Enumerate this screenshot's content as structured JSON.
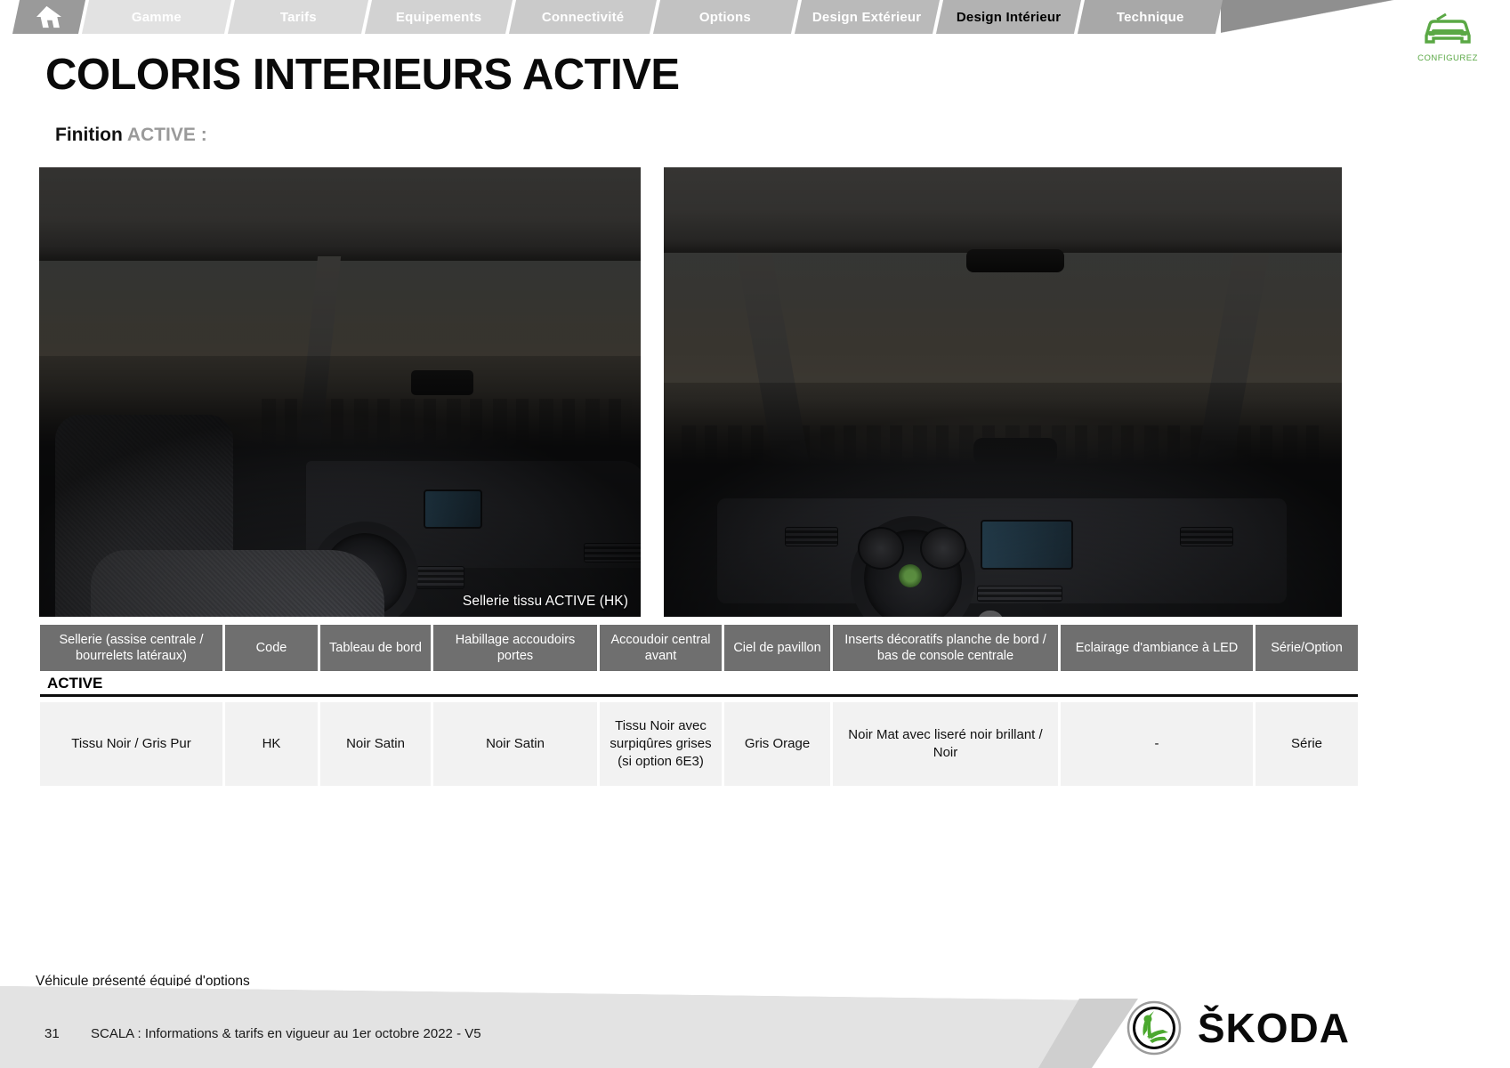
{
  "nav": {
    "home_icon": "home-icon",
    "tabs": [
      {
        "label": "Gamme",
        "active": false,
        "bg": "#e2e2e2"
      },
      {
        "label": "Tarifs",
        "active": false,
        "bg": "#dadada"
      },
      {
        "label": "Equipements",
        "active": false,
        "bg": "#d2d2d2"
      },
      {
        "label": "Connectivité",
        "active": false,
        "bg": "#cacaca"
      },
      {
        "label": "Options",
        "active": false,
        "bg": "#c2c2c2"
      },
      {
        "label": "Design Extérieur",
        "active": false,
        "bg": "#bababa"
      },
      {
        "label": "Design Intérieur",
        "active": true,
        "bg": "#b2b2b2"
      },
      {
        "label": "Technique",
        "active": false,
        "bg": "#a8a8a8"
      }
    ],
    "home_bg": "#9a9a9a"
  },
  "configurez": {
    "label": "CONFIGUREZ",
    "icon": "car-front-icon",
    "color": "#5aa845"
  },
  "header": {
    "title": "COLORIS INTERIEURS ACTIVE",
    "finition_label": "Finition",
    "finition_value": "ACTIVE :"
  },
  "photos": [
    {
      "name": "interior-seats-photo",
      "caption": ""
    },
    {
      "name": "interior-dashboard-photo",
      "caption": "Sellerie tissu ACTIVE (HK)"
    }
  ],
  "photo_caption": "Sellerie tissu ACTIVE (HK)",
  "table": {
    "headers": [
      "Sellerie (assise centrale / bourrelets latéraux)",
      "Code",
      "Tableau de bord",
      "Habillage accoudoirs portes",
      "Accoudoir central avant",
      "Ciel de pavillon",
      "Inserts décoratifs planche de bord / bas de console centrale",
      "Eclairage d'ambiance à LED",
      "Série/Option"
    ],
    "group_label": "ACTIVE",
    "rows": [
      [
        "Tissu Noir / Gris Pur",
        "HK",
        "Noir Satin",
        "Noir Satin",
        "Tissu Noir avec surpiqûres grises (si option 6E3)",
        "Gris Orage",
        "Noir Mat avec liseré noir brillant / Noir",
        "-",
        "Série"
      ]
    ]
  },
  "footer": {
    "note": "Véhicule présenté équipé d'options",
    "page_number": "31",
    "legal": "SCALA : Informations & tarifs en vigueur au 1er octobre 2022 - V5",
    "brand": "ŠKODA",
    "brand_icon": "skoda-arrow-logo"
  }
}
